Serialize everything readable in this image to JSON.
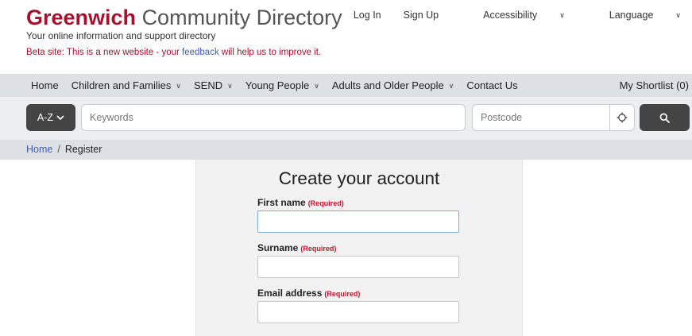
{
  "header": {
    "brand_strong": "Greenwich",
    "brand_light": "Community Directory",
    "tagline": "Your online information and support directory",
    "beta_prefix": "Beta site: This is a new website - your",
    "beta_link": "feedback",
    "beta_suffix": "will help us to improve it."
  },
  "top_links": {
    "login": "Log In",
    "signup": "Sign Up",
    "accessibility": "Accessibility",
    "language": "Language"
  },
  "nav": {
    "items": [
      {
        "label": "Home"
      },
      {
        "label": "Children and Families"
      },
      {
        "label": "SEND"
      },
      {
        "label": "Young People"
      },
      {
        "label": "Adults and Older People"
      },
      {
        "label": "Contact Us"
      }
    ],
    "shortlist": "My Shortlist (0)"
  },
  "search": {
    "az_label": "A-Z",
    "keywords_placeholder": "Keywords",
    "postcode_placeholder": "Postcode"
  },
  "breadcrumb": {
    "home": "Home",
    "separator": "/",
    "current": "Register"
  },
  "form": {
    "title": "Create your account",
    "required_label": "(Required)",
    "fields": [
      {
        "label": "First name",
        "value": ""
      },
      {
        "label": "Surname",
        "value": ""
      },
      {
        "label": "Email address",
        "value": ""
      }
    ]
  },
  "colors": {
    "brand": "#a5122d",
    "link": "#3b5ea8",
    "nav_bg": "#dde1e6",
    "button_dark": "#444444"
  }
}
